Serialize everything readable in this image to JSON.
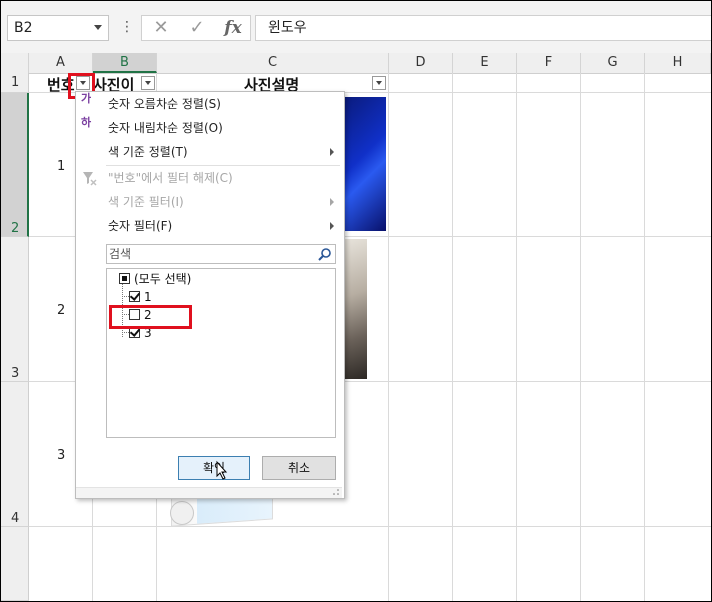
{
  "name_box": {
    "value": "B2"
  },
  "formula_bar": {
    "value": "윈도우",
    "buttons": {
      "cancel": "✕",
      "enter": "✓",
      "fx": "fx"
    }
  },
  "columns": [
    "A",
    "B",
    "C",
    "D",
    "E",
    "F",
    "G",
    "H"
  ],
  "selected_column": "B",
  "rows": [
    "1",
    "2",
    "3",
    "4"
  ],
  "selected_row": "2",
  "sheet": {
    "headers": {
      "a1": "번호",
      "b1": "사진이",
      "c1": "사진설명"
    },
    "row_values": {
      "a2": "1",
      "a3": "2",
      "a4": "3"
    }
  },
  "filter_menu": {
    "items": {
      "sort_asc": "숫자 오름차순 정렬(S)",
      "sort_desc": "숫자 내림차순 정렬(O)",
      "sort_color": "색 기준 정렬(T)",
      "clear_filter": "\"번호\"에서 필터 해제(C)",
      "filter_color": "색 기준 필터(I)",
      "number_filter": "숫자 필터(F)"
    },
    "search_placeholder": "검색",
    "values": [
      {
        "label": "(모두 선택)",
        "state": "indeterminate"
      },
      {
        "label": "1",
        "state": "checked"
      },
      {
        "label": "2",
        "state": "unchecked"
      },
      {
        "label": "3",
        "state": "checked"
      }
    ],
    "ok_label": "확인",
    "cancel_label": "취소"
  },
  "colors": {
    "accent": "#217346",
    "highlight": "#e0101e",
    "ok_border": "#3c7fb1"
  }
}
